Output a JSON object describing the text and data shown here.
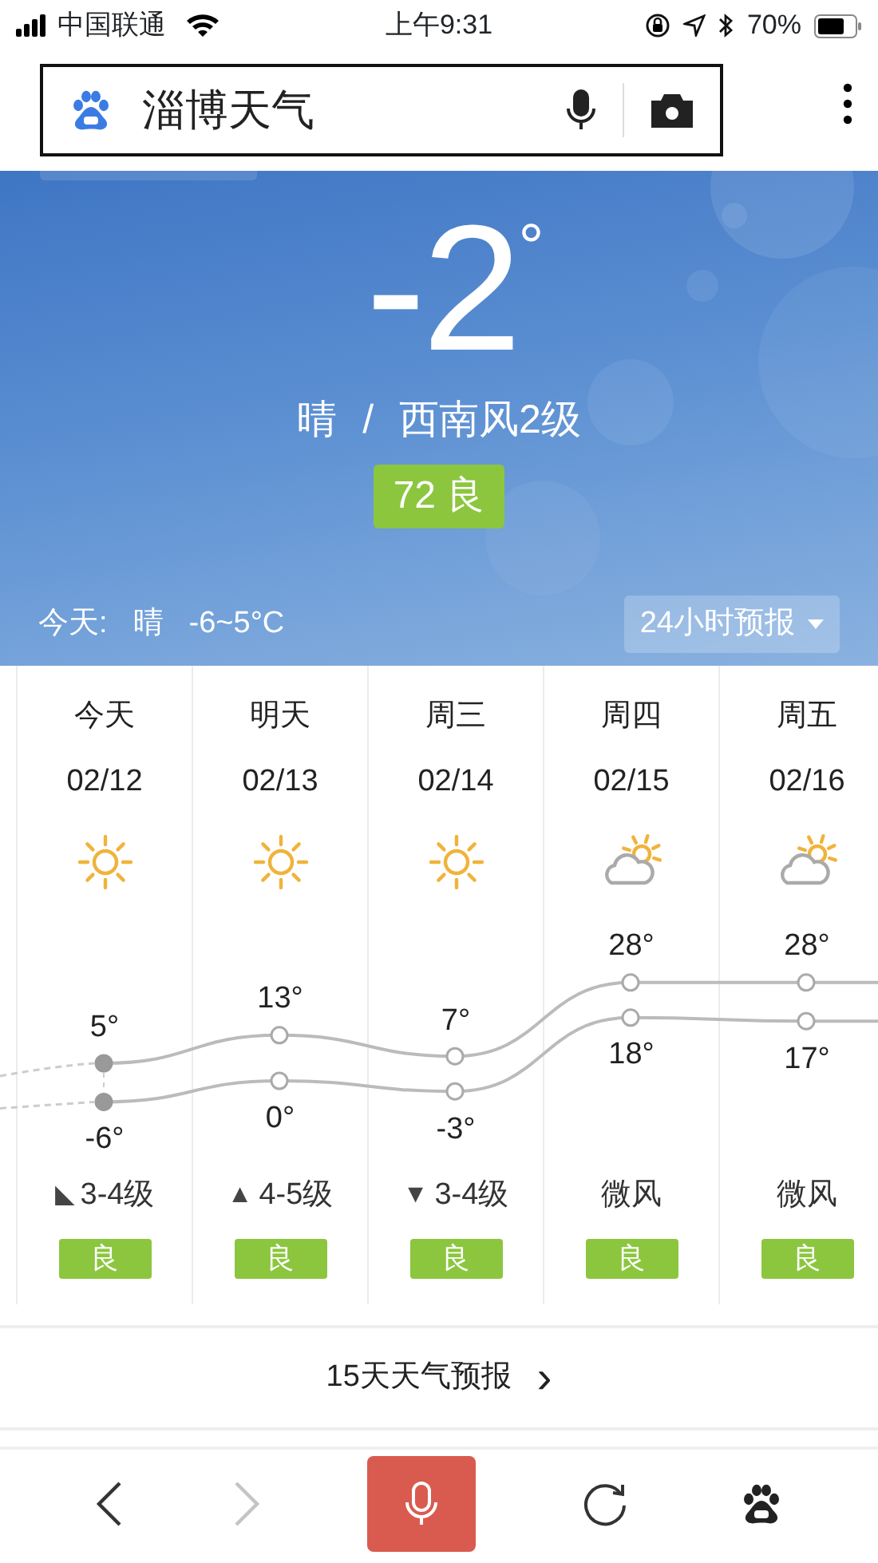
{
  "status_bar": {
    "carrier": "中国联通",
    "time": "上午9:31",
    "battery": "70%"
  },
  "search": {
    "value": "淄博天气"
  },
  "current": {
    "temperature": "-2",
    "degree": "°",
    "condition": "晴",
    "separator": "/",
    "wind": "西南风2级",
    "aqi": "72 良",
    "today_label": "今天:",
    "today_condition": "晴",
    "today_range": "-6~5°C",
    "forecast_button": "24小时预报"
  },
  "days": [
    {
      "kind": "sunny",
      "name": "今天",
      "date": "02/12",
      "high": "5°",
      "low": "-6°",
      "current": true,
      "wind_arrow": "◣",
      "wind": "3-4级",
      "aqi": "良"
    },
    {
      "kind": "sunny",
      "name": "明天",
      "date": "02/13",
      "high": "13°",
      "low": "0°",
      "current": false,
      "wind_arrow": "▲",
      "wind": "4-5级",
      "aqi": "良"
    },
    {
      "kind": "sunny",
      "name": "周三",
      "date": "02/14",
      "high": "7°",
      "low": "-3°",
      "current": false,
      "wind_arrow": "▼",
      "wind": "3-4级",
      "aqi": "良"
    },
    {
      "kind": "partly_cloudy",
      "name": "周四",
      "date": "02/15",
      "high": "28°",
      "low": "18°",
      "current": false,
      "wind": "微风",
      "aqi": "良"
    },
    {
      "kind": "partly_cloudy",
      "name": "周五",
      "date": "02/16",
      "high": "28°",
      "low": "17°",
      "current": false,
      "wind": "微风",
      "aqi": "良"
    }
  ],
  "more_link": {
    "label": "15天天气预报",
    "chevron": "›"
  },
  "bottom_bar": {
    "back_disabled": false,
    "forward_disabled": true
  }
}
